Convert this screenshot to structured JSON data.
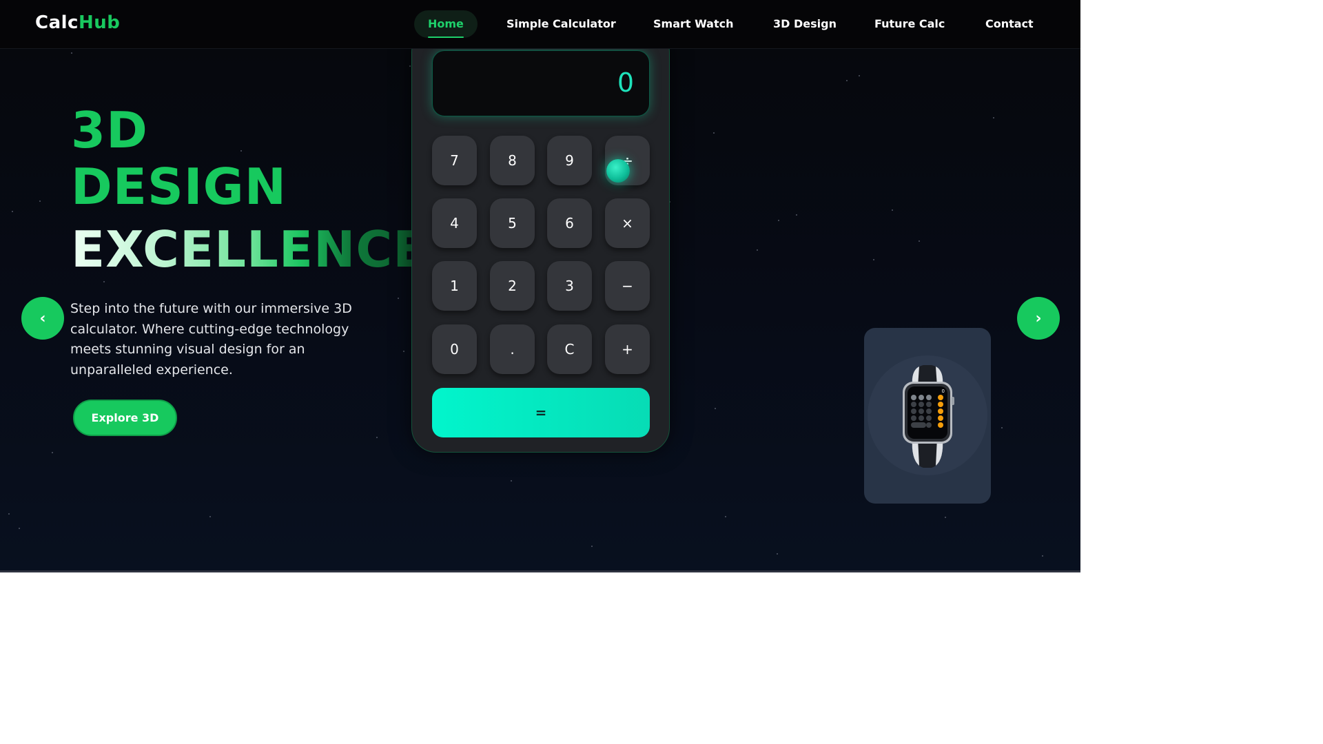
{
  "brand": {
    "part1": "Calc",
    "part2": "Hub",
    "accent": "#19c95f"
  },
  "nav": {
    "items": [
      {
        "label": "Home",
        "active": true
      },
      {
        "label": "Simple Calculator",
        "active": false
      },
      {
        "label": "Smart Watch",
        "active": false
      },
      {
        "label": "3D Design",
        "active": false
      },
      {
        "label": "Future Calc",
        "active": false
      },
      {
        "label": "Contact",
        "active": false
      }
    ]
  },
  "hero": {
    "title_line1": "3D",
    "title_line2": "DESIGN",
    "title_line3": "EXCELLENCE",
    "description": "Step into the future with our immersive 3D calculator. Where cutting-edge technology meets stunning visual design for an unparalleled experience.",
    "cta_label": "Explore 3D",
    "prev_icon": "chevron-left-icon",
    "next_icon": "chevron-right-icon",
    "prev_glyph": "‹",
    "next_glyph": "›"
  },
  "calculator": {
    "display": "0",
    "keys": {
      "k7": "7",
      "k8": "8",
      "k9": "9",
      "div": "÷",
      "k4": "4",
      "k5": "5",
      "k6": "6",
      "mul": "×",
      "k1": "1",
      "k2": "2",
      "k3": "3",
      "sub": "−",
      "k0": "0",
      "dot": ".",
      "clear": "C",
      "add": "+"
    },
    "equals": "=",
    "display_color": "#1ee3bb",
    "equals_color": "#02f5cc"
  },
  "watch": {
    "display_value": "0",
    "keys": [
      "AC",
      "+/-",
      "%",
      "÷",
      "7",
      "8",
      "9",
      "×",
      "4",
      "5",
      "6",
      "−",
      "1",
      "2",
      "3",
      "+",
      "0",
      ".",
      "="
    ]
  },
  "colors": {
    "green": "#17c95e",
    "background": "#070b16",
    "card": "#283447"
  }
}
